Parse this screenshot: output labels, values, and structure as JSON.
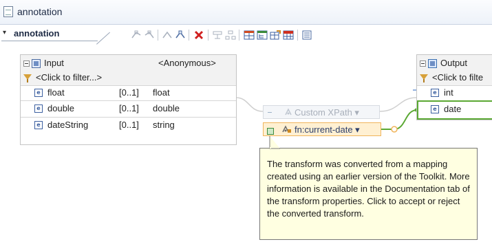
{
  "window": {
    "title": "annotation",
    "icon": "document-icon"
  },
  "toolbar": {
    "breadcrumb_label": "annotation",
    "breadcrumb_caret": "▾",
    "icons": [
      "wire-left-icon",
      "wire-right-icon",
      "connect-left-icon",
      "connect-right-icon",
      "delete-icon",
      "align-icon",
      "layout-icon",
      "table-icon",
      "tree-icon",
      "edit-table-icon",
      "grid-icon",
      "properties-icon"
    ]
  },
  "input_panel": {
    "title": "Input",
    "type": "<Anonymous>",
    "filter": "<Click to filter...>",
    "fields": [
      {
        "name": "float",
        "cardinality": "[0..1]",
        "type": "float"
      },
      {
        "name": "double",
        "cardinality": "[0..1]",
        "type": "double"
      },
      {
        "name": "dateString",
        "cardinality": "[0..1]",
        "type": "string"
      }
    ]
  },
  "output_panel": {
    "title": "Output",
    "filter": "<Click to filte",
    "fields": [
      {
        "name": "int"
      },
      {
        "name": "date"
      }
    ]
  },
  "transforms": [
    {
      "label": "Custom XPath ▾",
      "state": "disabled"
    },
    {
      "label": "fn:current-date ▾",
      "state": "active"
    }
  ],
  "tooltip": {
    "text": "The transform was converted from a mapping created using an earlier version of the Toolkit. More information is available in the Documentation tab of the transform properties. Click to accept or reject the converted transform."
  },
  "colors": {
    "connection_green": "#5aa832",
    "connection_gray": "#c9c9c9",
    "connection_blue": "#6f98d2",
    "tooltip_bg": "#ffffe1",
    "active_transform_bg": "#fff0d2"
  }
}
